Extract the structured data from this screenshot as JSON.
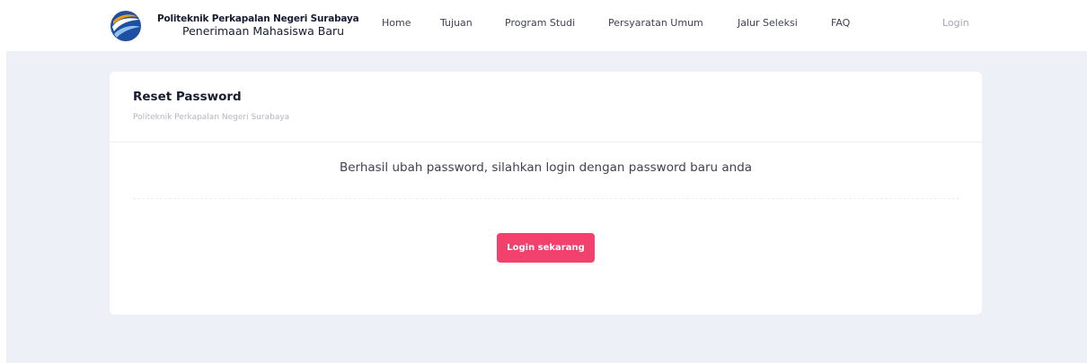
{
  "brand": {
    "logo_icon": "polytechnic-logo-icon",
    "title": "Politeknik Perkapalan Negeri Surabaya",
    "subtitle": "Penerimaan Mahasiswa Baru"
  },
  "nav": {
    "items": [
      {
        "label": "Home"
      },
      {
        "label": "Tujuan"
      },
      {
        "label": "Program Studi"
      },
      {
        "label": "Persyaratan Umum"
      },
      {
        "label": "Jalur Seleksi"
      },
      {
        "label": "FAQ"
      }
    ],
    "login": "Login"
  },
  "card": {
    "title": "Reset Password",
    "subtitle": "Politeknik Perkapalan Negeri Surabaya",
    "message": "Berhasil ubah password, silahkan login dengan password baru anda",
    "button_label": "Login sekarang"
  },
  "colors": {
    "accent_button": "#f1416c",
    "page_background": "#eef0f8",
    "logo_blue": "#1e4fa3",
    "logo_orange": "#f39c12"
  }
}
